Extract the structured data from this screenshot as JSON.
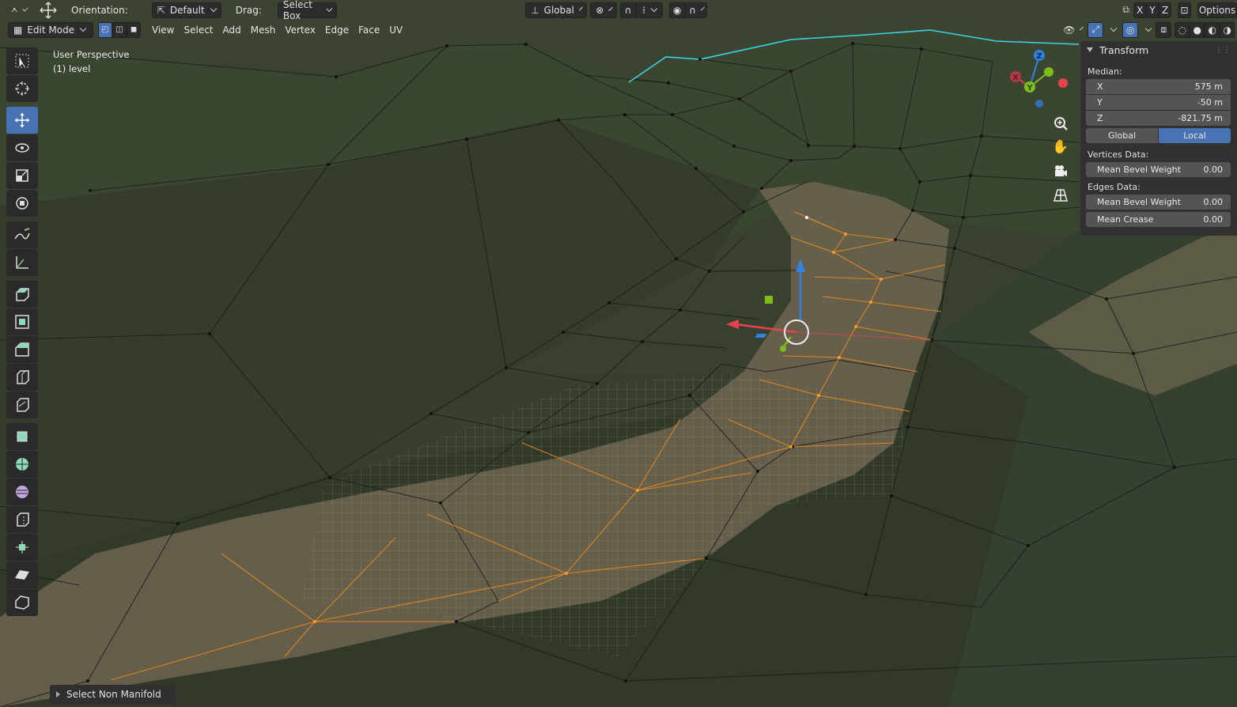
{
  "tool_header": {
    "orientation_label": "Orientation:",
    "orientation_value": "Default",
    "drag_label": "Drag:",
    "drag_value": "Select Box",
    "transform_orientation": "Global",
    "axis_x": "X",
    "axis_y": "Y",
    "axis_z": "Z",
    "options_label": "Options"
  },
  "view_header": {
    "mode": "Edit Mode",
    "menus": [
      "View",
      "Select",
      "Add",
      "Mesh",
      "Vertex",
      "Edge",
      "Face",
      "UV"
    ],
    "select_mode_active": "vertex"
  },
  "overlay": {
    "perspective": "User Perspective",
    "collection": "(1) level"
  },
  "toolbar": {
    "tools": [
      {
        "name": "select-box-tool",
        "icon": "select-box-icon",
        "active": false
      },
      {
        "name": "cursor-tool",
        "icon": "cursor-icon",
        "active": false
      },
      {
        "name": "move-tool",
        "icon": "move-icon",
        "active": true
      },
      {
        "name": "rotate-tool",
        "icon": "rotate-icon",
        "active": false
      },
      {
        "name": "scale-tool",
        "icon": "scale-icon",
        "active": false
      },
      {
        "name": "transform-tool",
        "icon": "transform-icon",
        "active": false
      },
      {
        "name": "annotate-tool",
        "icon": "annotate-icon",
        "active": false
      },
      {
        "name": "measure-tool",
        "icon": "measure-icon",
        "active": false
      },
      {
        "name": "extrude-tool",
        "icon": "extrude-icon",
        "active": false
      },
      {
        "name": "inset-tool",
        "icon": "inset-icon",
        "active": false
      },
      {
        "name": "bevel-tool",
        "icon": "bevel-icon",
        "active": false
      },
      {
        "name": "loop-cut-tool",
        "icon": "loop-cut-icon",
        "active": false
      },
      {
        "name": "knife-tool",
        "icon": "knife-icon",
        "active": false
      },
      {
        "name": "poly-build-tool",
        "icon": "poly-build-icon",
        "active": false
      },
      {
        "name": "spin-tool",
        "icon": "spin-icon",
        "active": false
      },
      {
        "name": "smooth-tool",
        "icon": "smooth-icon",
        "active": false
      },
      {
        "name": "edge-slide-tool",
        "icon": "edge-slide-icon",
        "active": false
      },
      {
        "name": "shrink-fatten-tool",
        "icon": "shrink-fatten-icon",
        "active": false
      },
      {
        "name": "shear-tool",
        "icon": "shear-icon",
        "active": false
      },
      {
        "name": "rip-tool",
        "icon": "rip-icon",
        "active": false
      }
    ]
  },
  "npanel": {
    "title": "Transform",
    "median_label": "Median:",
    "median": [
      {
        "axis": "X",
        "value": "575 m"
      },
      {
        "axis": "Y",
        "value": "-50 m"
      },
      {
        "axis": "Z",
        "value": "-821.75 m"
      }
    ],
    "space_global": "Global",
    "space_local": "Local",
    "vertices_label": "Vertices Data:",
    "vertex_bevel_label": "Mean Bevel Weight",
    "vertex_bevel_value": "0.00",
    "edges_label": "Edges Data:",
    "edge_bevel_label": "Mean Bevel Weight",
    "edge_bevel_value": "0.00",
    "crease_label": "Mean Crease",
    "crease_value": "0.00"
  },
  "gizmo": {
    "x": "X",
    "y": "Y",
    "z": "Z",
    "colors": {
      "x": "#e8414f",
      "y": "#7fbb1b",
      "z": "#2f83e3"
    }
  },
  "operator": {
    "label": "Select Non Manifold"
  },
  "colors": {
    "accent": "#4772b3",
    "selected_edge": "#e8891c",
    "boundary_edge": "#3ad3e8",
    "terrain": "#3a4430",
    "path": "#7a705a"
  }
}
